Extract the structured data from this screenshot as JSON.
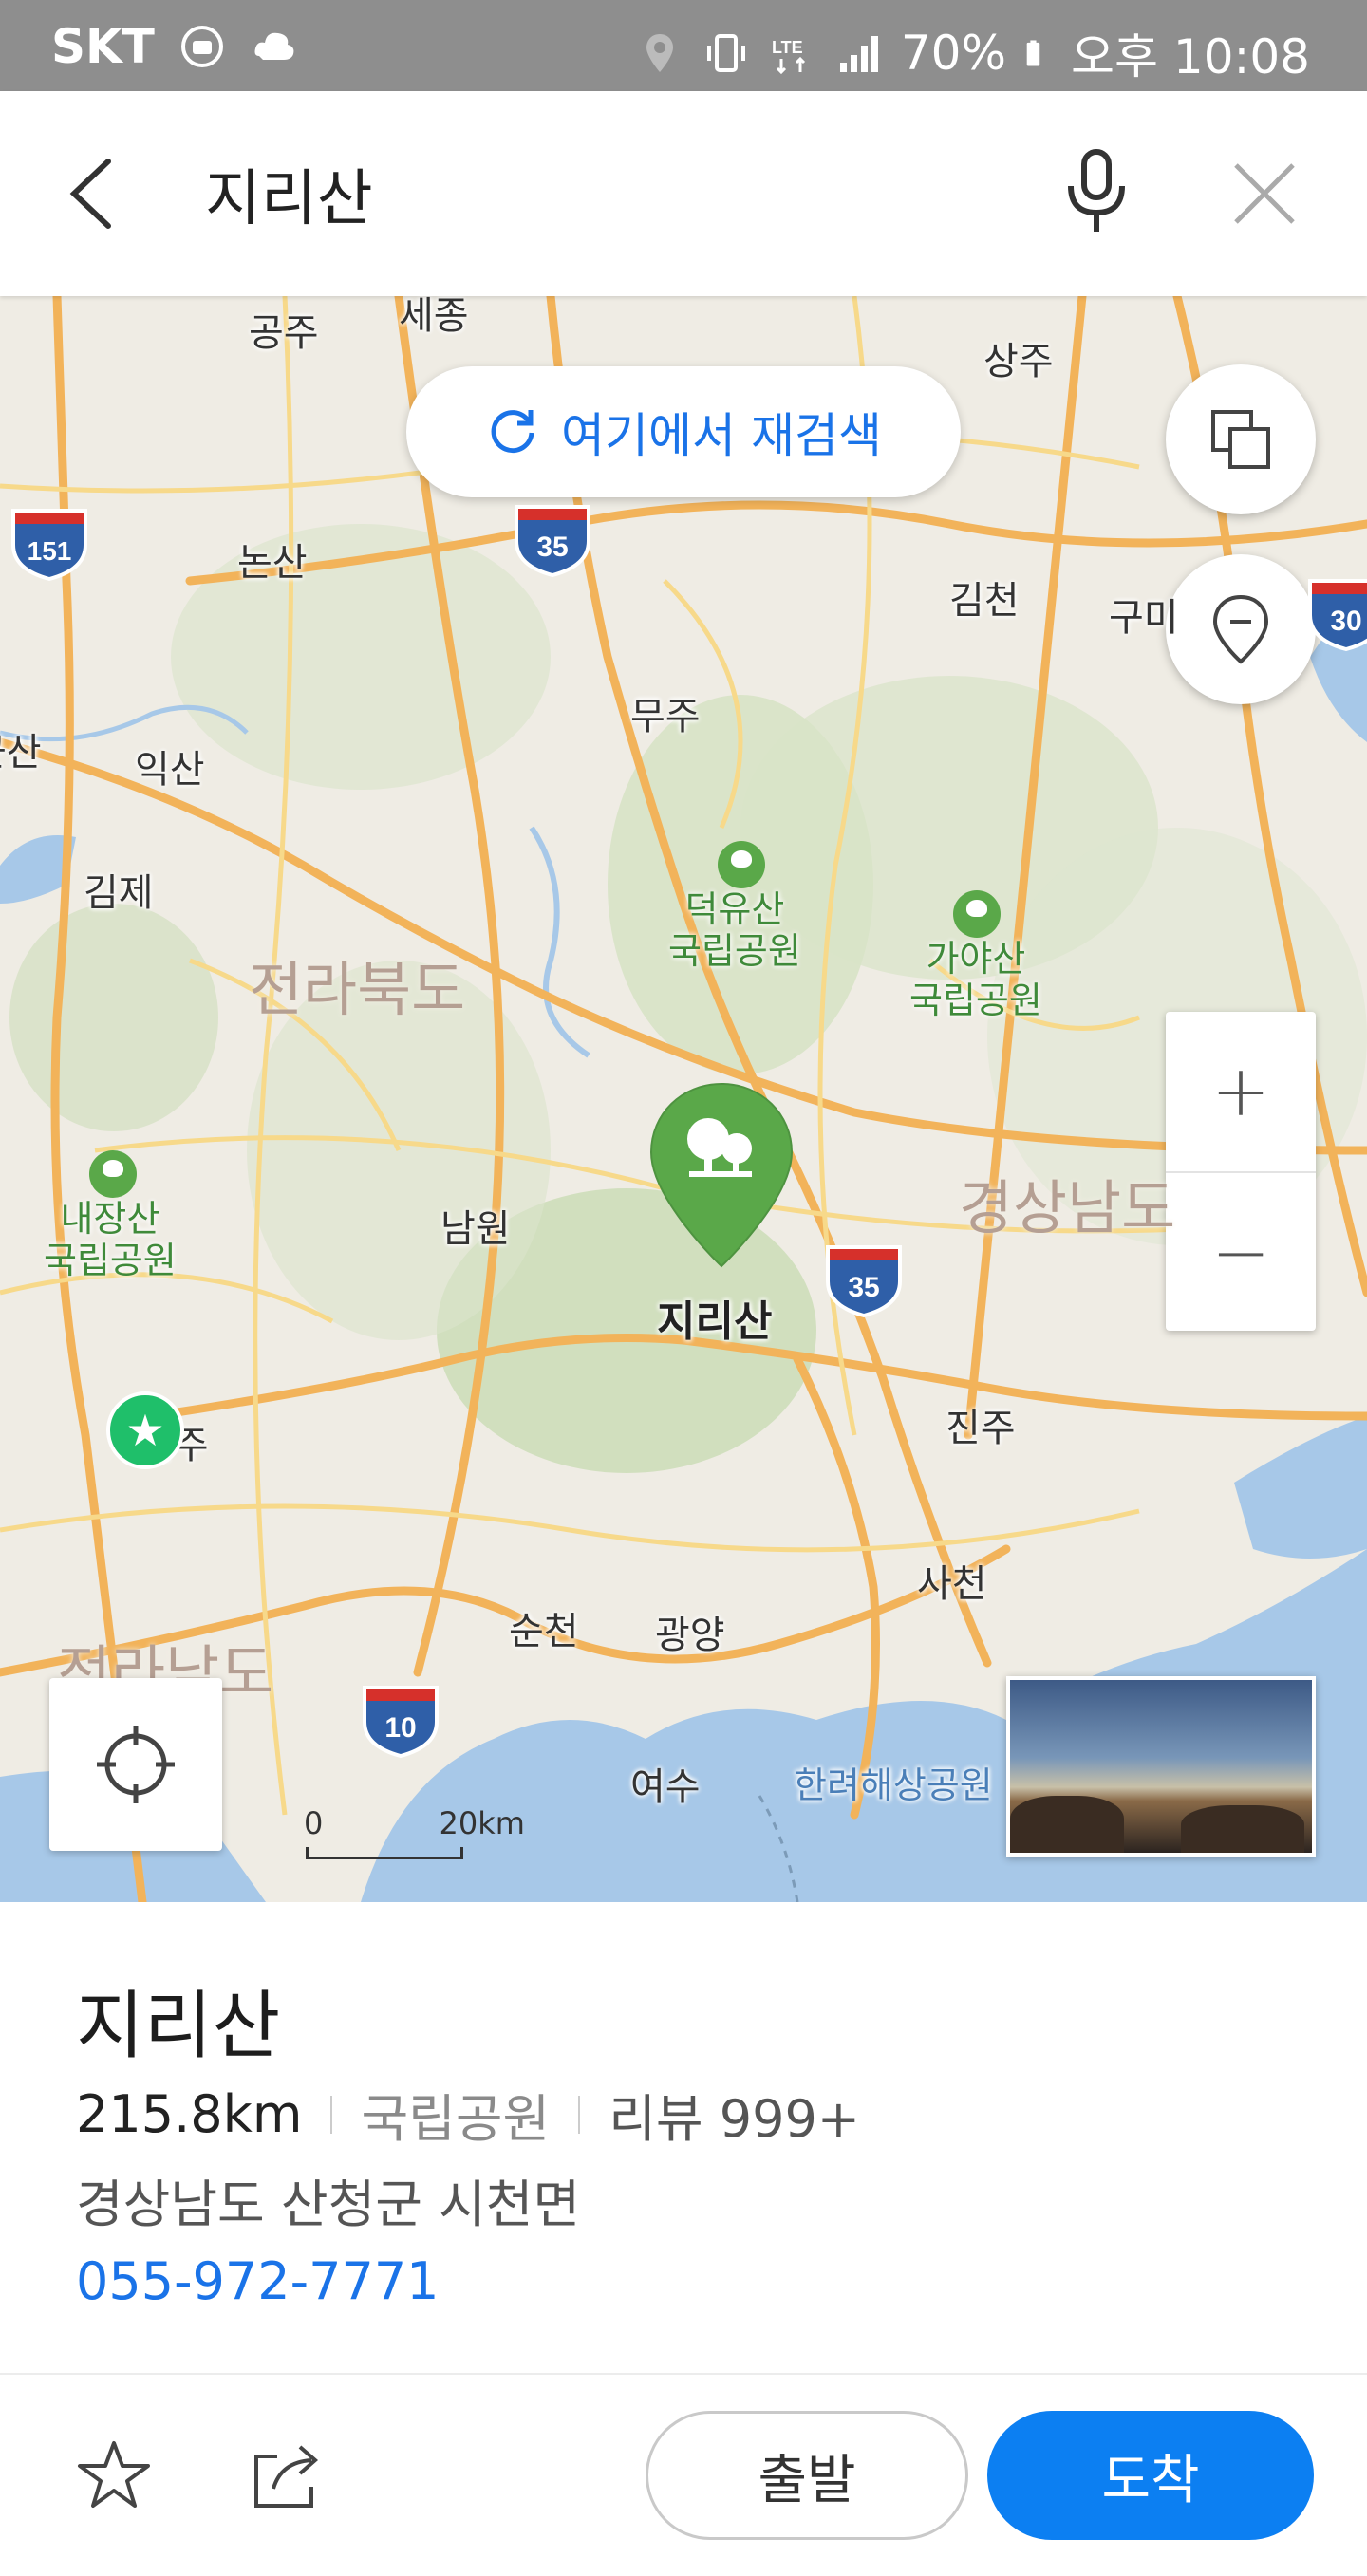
{
  "status_bar": {
    "carrier": "SKT",
    "battery": "70%",
    "time": "오후 10:08"
  },
  "search": {
    "query": "지리산",
    "icons": {
      "back": "back-arrow-icon",
      "mic": "microphone-icon",
      "clear": "close-icon"
    }
  },
  "map": {
    "research_label": "여기에서 재검색",
    "city_labels": [
      "공주",
      "세종",
      "상주",
      "논산",
      "김천",
      "구미",
      "무주",
      "군산",
      "익산",
      "김제",
      "남원",
      "진주",
      "전주",
      "사천",
      "순천",
      "광양",
      "여수"
    ],
    "region_labels": [
      "전라북도",
      "경상남도",
      "전라남도"
    ],
    "parks": [
      {
        "name": "덕유산\n국립공원"
      },
      {
        "name": "가야산\n국립공원"
      },
      {
        "name": "내장산\n국립공원"
      }
    ],
    "highways": [
      "151",
      "35",
      "30",
      "35",
      "10"
    ],
    "marine_park_label": "한려해상공원",
    "selected_place": "지리산",
    "scale_zero": "0",
    "scale_distance": "20km",
    "zoom_in": "+",
    "zoom_out": "−"
  },
  "place": {
    "name": "지리산",
    "distance": "215.8km",
    "category": "국립공원",
    "reviews": "리뷰 999+",
    "address": "경상남도 산청군 시천면",
    "phone": "055-972-7771"
  },
  "actions": {
    "depart": "출발",
    "arrive": "도착"
  },
  "colors": {
    "accent": "#1a73e8",
    "arrive_button": "#0c7ff2",
    "park_green": "#5aa849",
    "road_orange": "#f2b35a",
    "water": "#a7c8e8"
  }
}
